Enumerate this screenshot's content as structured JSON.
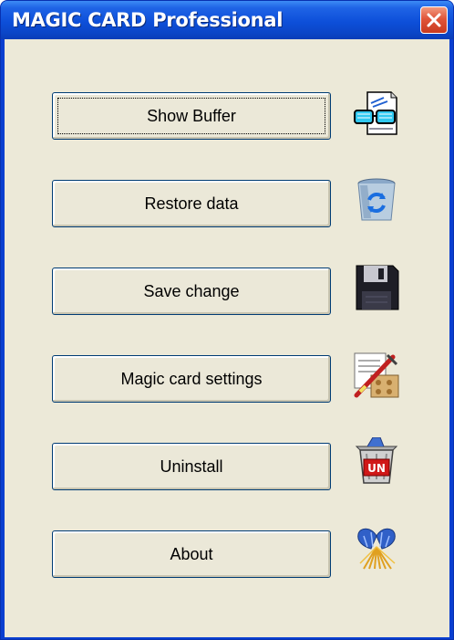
{
  "window": {
    "title": "MAGIC CARD Professional"
  },
  "buttons": [
    {
      "label": "Show Buffer",
      "icon": "glasses-document-icon"
    },
    {
      "label": "Restore data",
      "icon": "recycle-bin-icon"
    },
    {
      "label": "Save change",
      "icon": "floppy-disk-icon"
    },
    {
      "label": "Magic card settings",
      "icon": "settings-tools-icon"
    },
    {
      "label": "Uninstall",
      "icon": "uninstall-bin-icon"
    },
    {
      "label": "About",
      "icon": "about-logo-icon"
    }
  ],
  "colors": {
    "titlebar": "#0b4fd9",
    "client_background": "#ece9d8",
    "close_button": "#e0553a"
  }
}
